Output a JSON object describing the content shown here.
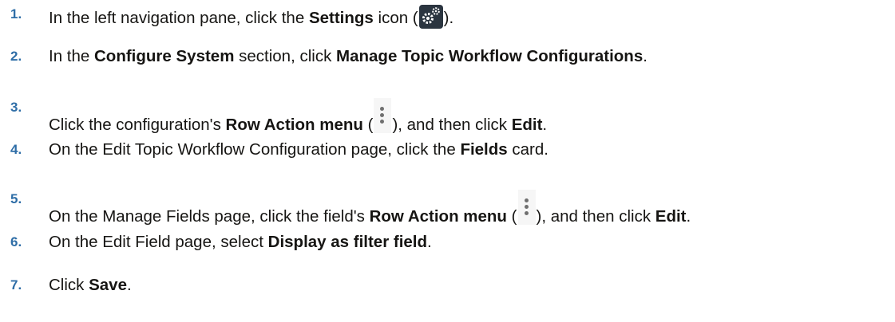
{
  "steps": [
    {
      "number": "1.",
      "parts": [
        "In the left navigation pane, click the ",
        "Settings",
        " icon (",
        ")."
      ]
    },
    {
      "number": "2.",
      "parts": [
        "In the ",
        "Configure System",
        " section, click ",
        "Manage Topic Workflow Configurations",
        "."
      ]
    },
    {
      "number": "3.",
      "parts": [
        "Click the configuration's ",
        "Row Action menu",
        " (",
        "), and then click ",
        "Edit",
        "."
      ]
    },
    {
      "number": "4.",
      "parts": [
        "On the Edit Topic Workflow Configuration page, click the ",
        "Fields",
        " card."
      ]
    },
    {
      "number": "5.",
      "parts": [
        "On the Manage Fields page, click the field's ",
        "Row Action menu",
        " (",
        "), and then click ",
        "Edit",
        "."
      ]
    },
    {
      "number": "6.",
      "parts": [
        "On the Edit Field page, select ",
        "Display as filter field",
        "."
      ]
    },
    {
      "number": "7.",
      "parts": [
        "Click ",
        "Save",
        "."
      ]
    }
  ],
  "icons": {
    "step1": "gear-icon",
    "step3": "kebab-icon",
    "step5": "kebab-icon"
  },
  "colors": {
    "step_number": "#2f6ea7",
    "text": "#161513"
  }
}
